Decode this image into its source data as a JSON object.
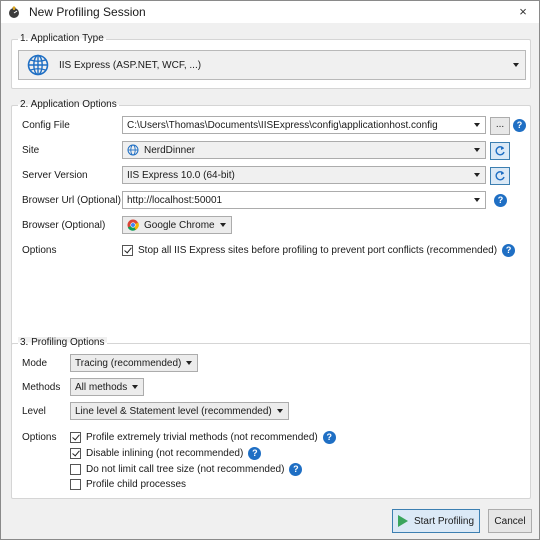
{
  "window": {
    "title": "New Profiling Session",
    "close_glyph": "×"
  },
  "section1": {
    "legend": "1. Application Type",
    "app_type_value": "IIS Express (ASP.NET, WCF, ...)",
    "icon": "globe-icon"
  },
  "section2": {
    "legend": "2. Application Options",
    "config_file": {
      "label": "Config File",
      "value": "C:\\Users\\Thomas\\Documents\\IISExpress\\config\\applicationhost.config",
      "browse_label": "..."
    },
    "site": {
      "label": "Site",
      "value": "NerdDinner"
    },
    "server_version": {
      "label": "Server Version",
      "value": "IIS Express 10.0 (64-bit)"
    },
    "browser_url": {
      "label": "Browser Url (Optional)",
      "value": "http://localhost:50001"
    },
    "browser": {
      "label": "Browser (Optional)",
      "value": "Google Chrome"
    },
    "options": {
      "label": "Options",
      "stop_sites_label": "Stop all IIS Express sites before profiling to prevent port conflicts (recommended)",
      "stop_sites_checked": true
    }
  },
  "section3": {
    "legend": "3. Profiling Options",
    "mode": {
      "label": "Mode",
      "value": "Tracing (recommended)"
    },
    "methods": {
      "label": "Methods",
      "value": "All methods"
    },
    "level": {
      "label": "Level",
      "value": "Line level & Statement level (recommended)"
    },
    "options": {
      "label": "Options",
      "items": [
        {
          "label": "Profile extremely trivial methods (not recommended)",
          "checked": true,
          "help": true
        },
        {
          "label": "Disable inlining (not recommended)",
          "checked": true,
          "help": true
        },
        {
          "label": "Do not limit call tree size (not recommended)",
          "checked": false,
          "help": true
        },
        {
          "label": "Profile child processes",
          "checked": false,
          "help": false
        }
      ]
    }
  },
  "footer": {
    "start_label": "Start Profiling",
    "cancel_label": "Cancel"
  },
  "help_glyph": "?",
  "colors": {
    "accent_blue": "#1f6fc4",
    "button_blue_border": "#3c7fb1",
    "play_green": "#3aa55d"
  }
}
